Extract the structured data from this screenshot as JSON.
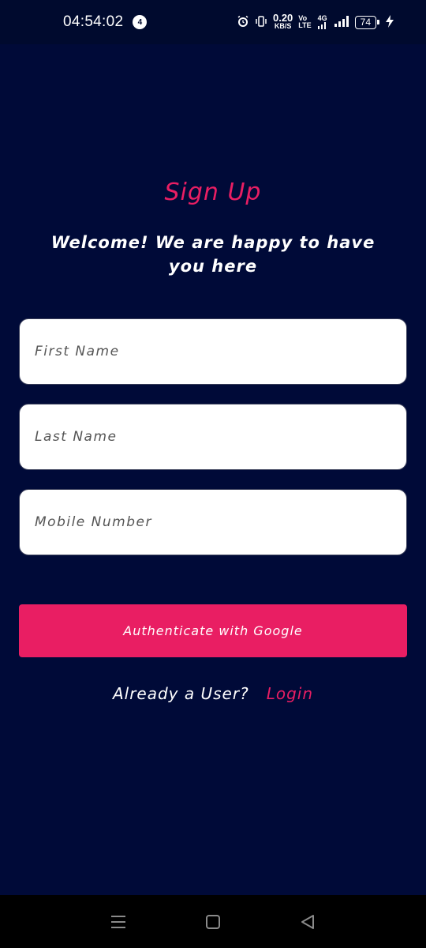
{
  "status_bar": {
    "time": "04:54:02",
    "notification_count": "4",
    "net_speed_value": "0.20",
    "net_speed_unit": "KB/S",
    "volte_top": "Vo",
    "volte_bottom": "LTE",
    "network": "4G",
    "battery": "74"
  },
  "page": {
    "title": "Sign Up",
    "subtitle": "Welcome! We are happy to have you here"
  },
  "form": {
    "first_name_placeholder": "First Name",
    "last_name_placeholder": "Last Name",
    "mobile_placeholder": "Mobile Number",
    "google_button_label": "Authenticate with Google"
  },
  "login": {
    "question": "Already a User?",
    "link_label": "Login"
  },
  "colors": {
    "background": "#000a38",
    "accent": "#e91e63"
  }
}
